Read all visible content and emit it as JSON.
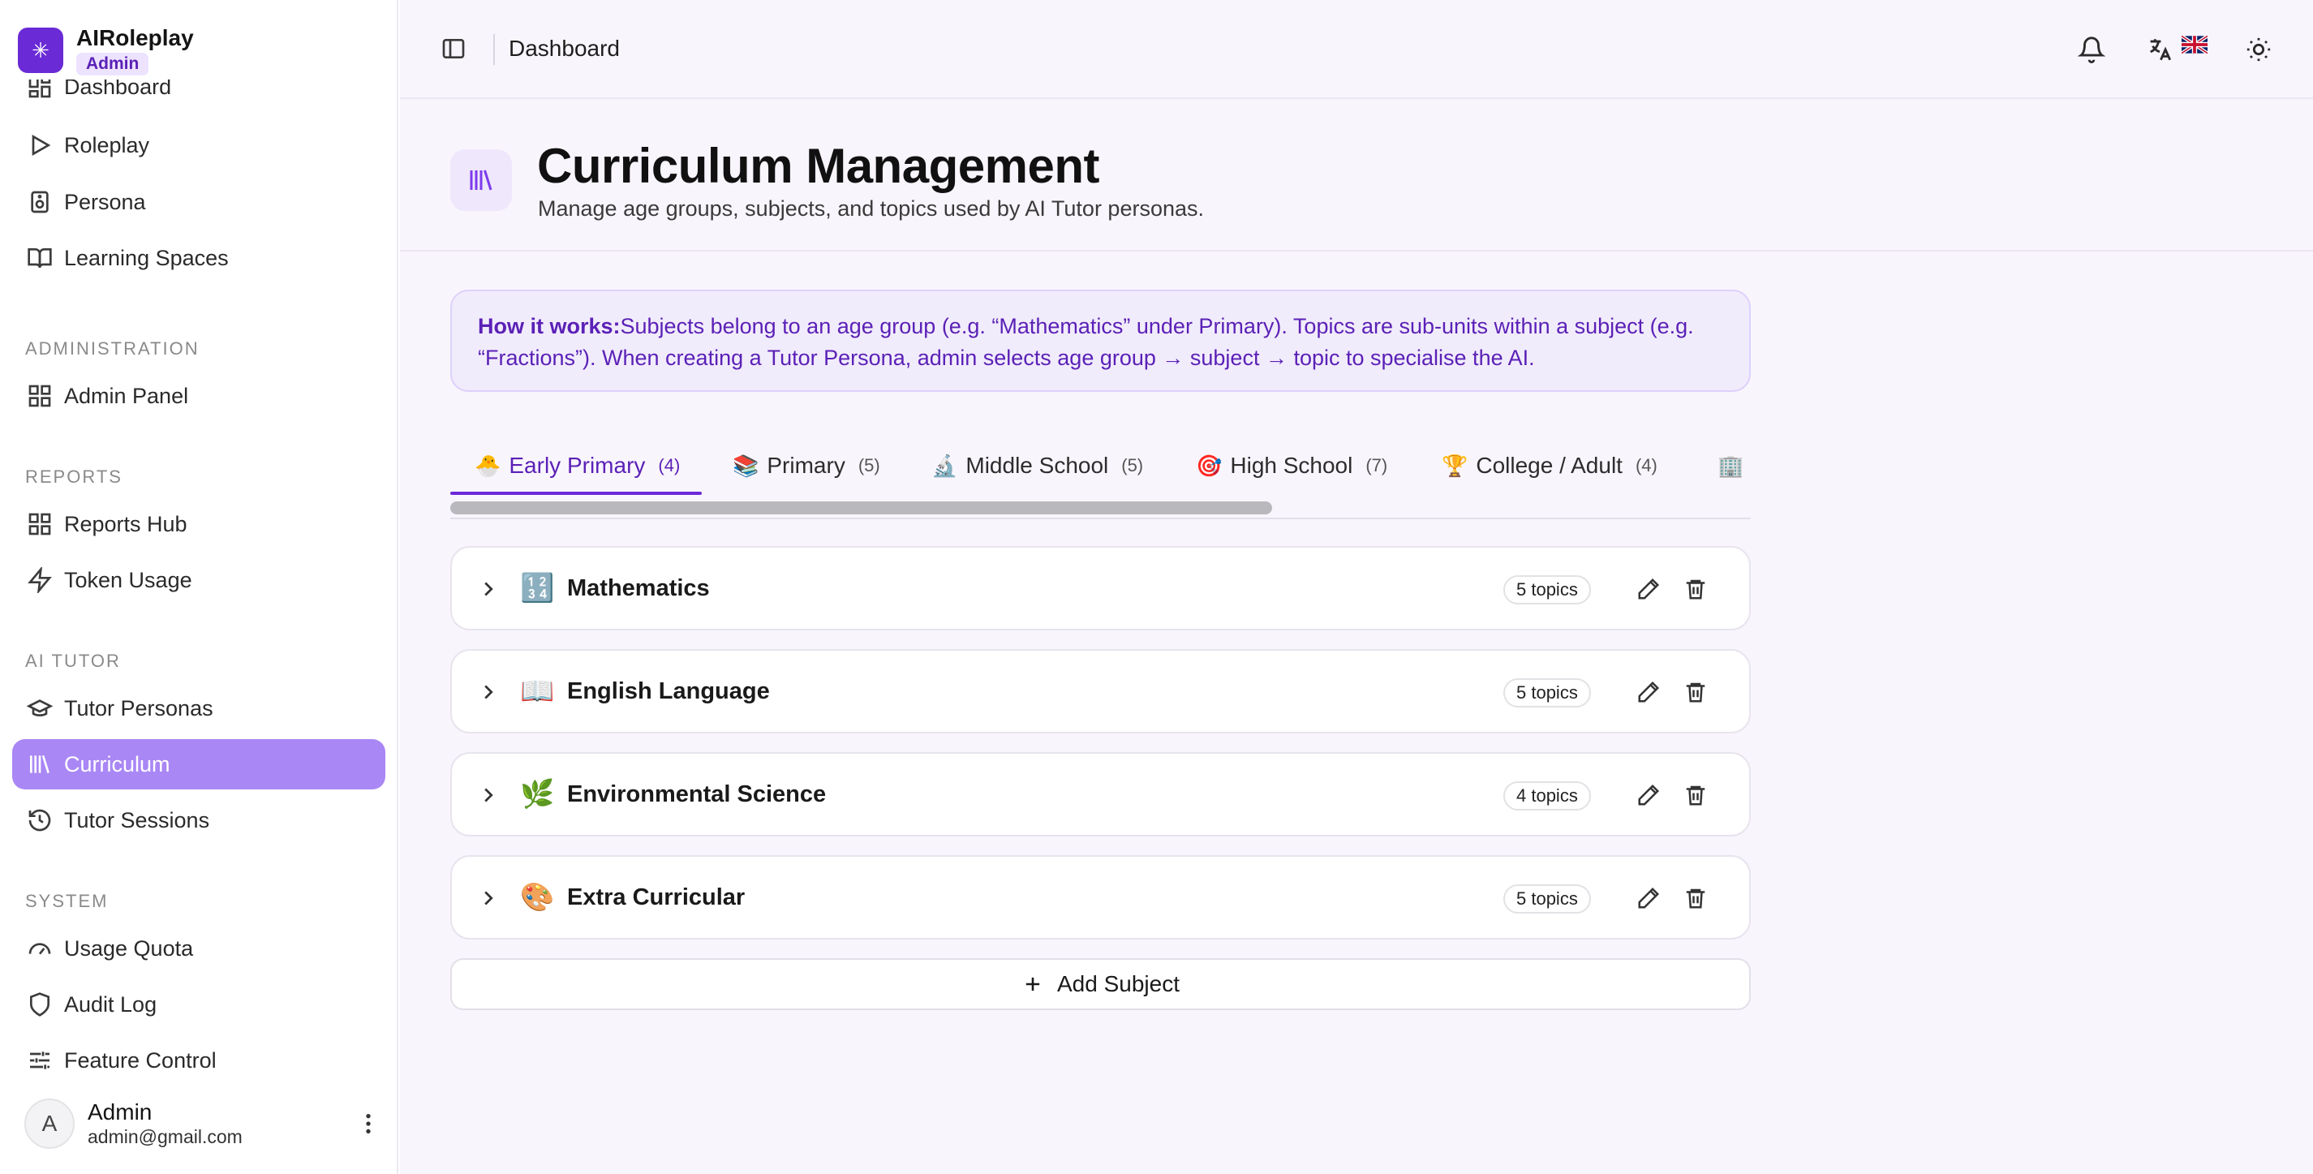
{
  "brand": {
    "name": "AIRoleplay",
    "badge": "Admin",
    "logo_icon": "sparkle-icon"
  },
  "sidebar": {
    "items": [
      {
        "label": "Dashboard",
        "icon": "layout-dashboard-icon"
      },
      {
        "label": "Roleplay",
        "icon": "play-icon"
      },
      {
        "label": "Persona",
        "icon": "speaker-icon"
      },
      {
        "label": "Learning Spaces",
        "icon": "book-open-icon"
      },
      {
        "label": "Admin Panel",
        "icon": "grid-icon"
      },
      {
        "label": "Reports Hub",
        "icon": "grid-icon"
      },
      {
        "label": "Token Usage",
        "icon": "zap-icon"
      },
      {
        "label": "Tutor Personas",
        "icon": "graduation-cap-icon"
      },
      {
        "label": "Curriculum",
        "icon": "library-icon",
        "active": true
      },
      {
        "label": "Tutor Sessions",
        "icon": "history-icon"
      },
      {
        "label": "Usage Quota",
        "icon": "gauge-icon"
      },
      {
        "label": "Audit Log",
        "icon": "shield-icon"
      },
      {
        "label": "Feature Control",
        "icon": "sliders-icon"
      }
    ],
    "sections": [
      "ADMINISTRATION",
      "REPORTS",
      "AI TUTOR",
      "SYSTEM"
    ]
  },
  "user": {
    "initial": "A",
    "name": "Admin",
    "email": "admin@gmail.com"
  },
  "topbar": {
    "title": "Dashboard",
    "flag": "🇬🇧"
  },
  "page": {
    "title": "Curriculum Management",
    "subtitle": "Manage age groups, subjects, and topics used by AI Tutor personas."
  },
  "info": {
    "label": "How it works:",
    "text": "Subjects belong to an age group (e.g. “Mathematics” under Primary). Topics are sub-units within a subject (e.g. “Fractions”). When creating a Tutor Persona, admin selects age group → subject → topic to specialise the AI."
  },
  "tabs": [
    {
      "emoji": "🐣",
      "label": "Early Primary",
      "count": "(4)",
      "active": true
    },
    {
      "emoji": "📚",
      "label": "Primary",
      "count": "(5)"
    },
    {
      "emoji": "🔬",
      "label": "Middle School",
      "count": "(5)"
    },
    {
      "emoji": "🎯",
      "label": "High School",
      "count": "(7)"
    },
    {
      "emoji": "🏆",
      "label": "College / Adult",
      "count": "(4)"
    },
    {
      "emoji": "🏢",
      "label": "",
      "count": ""
    }
  ],
  "subjects": [
    {
      "emoji": "🔢",
      "name": "Mathematics",
      "topics": "5 topics"
    },
    {
      "emoji": "📖",
      "name": "English Language",
      "topics": "5 topics"
    },
    {
      "emoji": "🌿",
      "name": "Environmental Science",
      "topics": "4 topics"
    },
    {
      "emoji": "🎨",
      "name": "Extra Curricular",
      "topics": "5 topics"
    }
  ],
  "add_subject_label": "Add Subject",
  "colors": {
    "accent": "#6d28d9",
    "active_nav": "#a987f5",
    "brand": "#6a2ad6"
  }
}
